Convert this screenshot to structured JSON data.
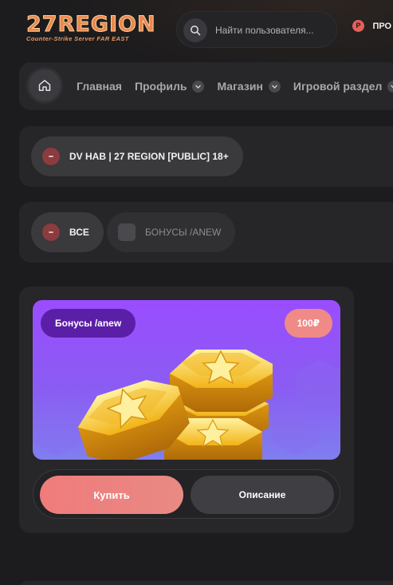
{
  "header": {
    "logo_main": "27REGION",
    "logo_sub": "Counter-Strike Server FAR EAST",
    "search_placeholder": "Найти пользователя...",
    "coin_symbol": "Р",
    "profile_label": "ПРО"
  },
  "nav": {
    "items": [
      {
        "label": "Главная",
        "has_dropdown": false
      },
      {
        "label": "Профиль",
        "has_dropdown": true
      },
      {
        "label": "Магазин",
        "has_dropdown": true
      },
      {
        "label": "Игровой раздел",
        "has_dropdown": true
      }
    ]
  },
  "server_filter": {
    "selected": "DV HAB | 27 REGION [PUBLIC] 18+"
  },
  "category_filter": {
    "all_label": "ВСЕ",
    "option_label": "БОНУСЫ /ANEW"
  },
  "product": {
    "title": "Бонусы /anew",
    "price": "100₽",
    "buy_label": "Купить",
    "description_label": "Описание"
  },
  "colors": {
    "background": "#1c1b1d",
    "panel": "#262528",
    "accent": "#f07b7b",
    "logo": "#e8894e",
    "card_gradient_top": "#9a4dff",
    "card_gradient_bottom": "#7f7ff0"
  },
  "icons": [
    "search-icon",
    "coin-icon",
    "home-icon",
    "chevron-down-icon",
    "gold-coins-illustration"
  ]
}
